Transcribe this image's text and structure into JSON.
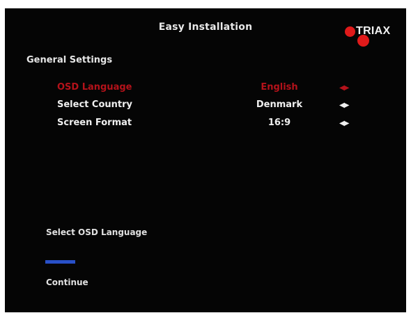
{
  "header": {
    "title": "Easy Installation",
    "brand": "TRIAX"
  },
  "section": {
    "title": "General Settings"
  },
  "settings": [
    {
      "label": "OSD Language",
      "value": "English",
      "arrows": "◀▶",
      "selected": true
    },
    {
      "label": "Select Country",
      "value": "Denmark",
      "arrows": "◀▶",
      "selected": false
    },
    {
      "label": "Screen Format",
      "value": "16:9",
      "arrows": "◀▶",
      "selected": false
    }
  ],
  "footer": {
    "hint": "Select OSD Language",
    "continue_label": "Continue",
    "continue_button_color": "#2850c8"
  },
  "colors": {
    "background": "#050505",
    "selected": "#b4121a",
    "text": "#f0f0f0",
    "brand_dots": "#e01a1a"
  }
}
